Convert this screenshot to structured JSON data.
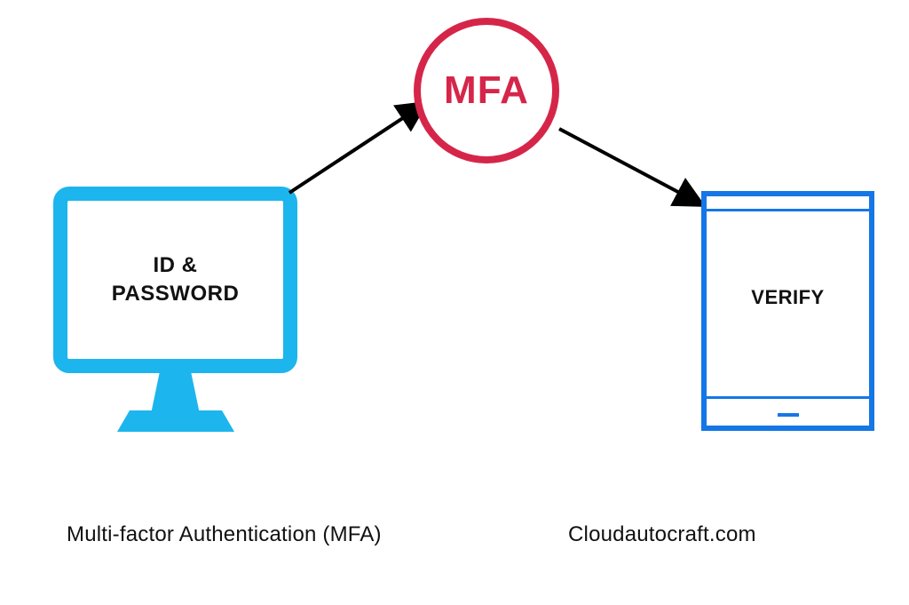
{
  "monitor": {
    "line1": "ID &",
    "line2": "PASSWORD"
  },
  "mfa": {
    "label": "MFA"
  },
  "device": {
    "label": "VERIFY"
  },
  "captions": {
    "left": "Multi-factor Authentication (MFA)",
    "right": "Cloudautocraft.com"
  }
}
